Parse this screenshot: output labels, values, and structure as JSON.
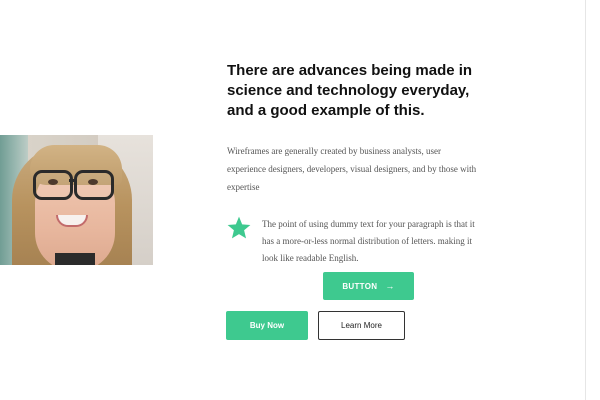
{
  "hero": {
    "headline": "There are advances being made in science and technology everyday, and a good example of this.",
    "paragraph": "Wireframes are generally created by business analysts, user experience designers, developers, visual designers, and by those with expertise"
  },
  "feature": {
    "icon": "star-icon",
    "text": "The point of using dummy text for your paragraph is that it has a more-or-less normal distribution of letters. making it look like readable English."
  },
  "buttons": {
    "primary_label": "BUTTON",
    "primary_arrow": "→",
    "buy_label": "Buy Now",
    "learn_label": "Learn More"
  },
  "colors": {
    "accent": "#3ec98f",
    "text_dark": "#111111",
    "text_body": "#555555"
  }
}
